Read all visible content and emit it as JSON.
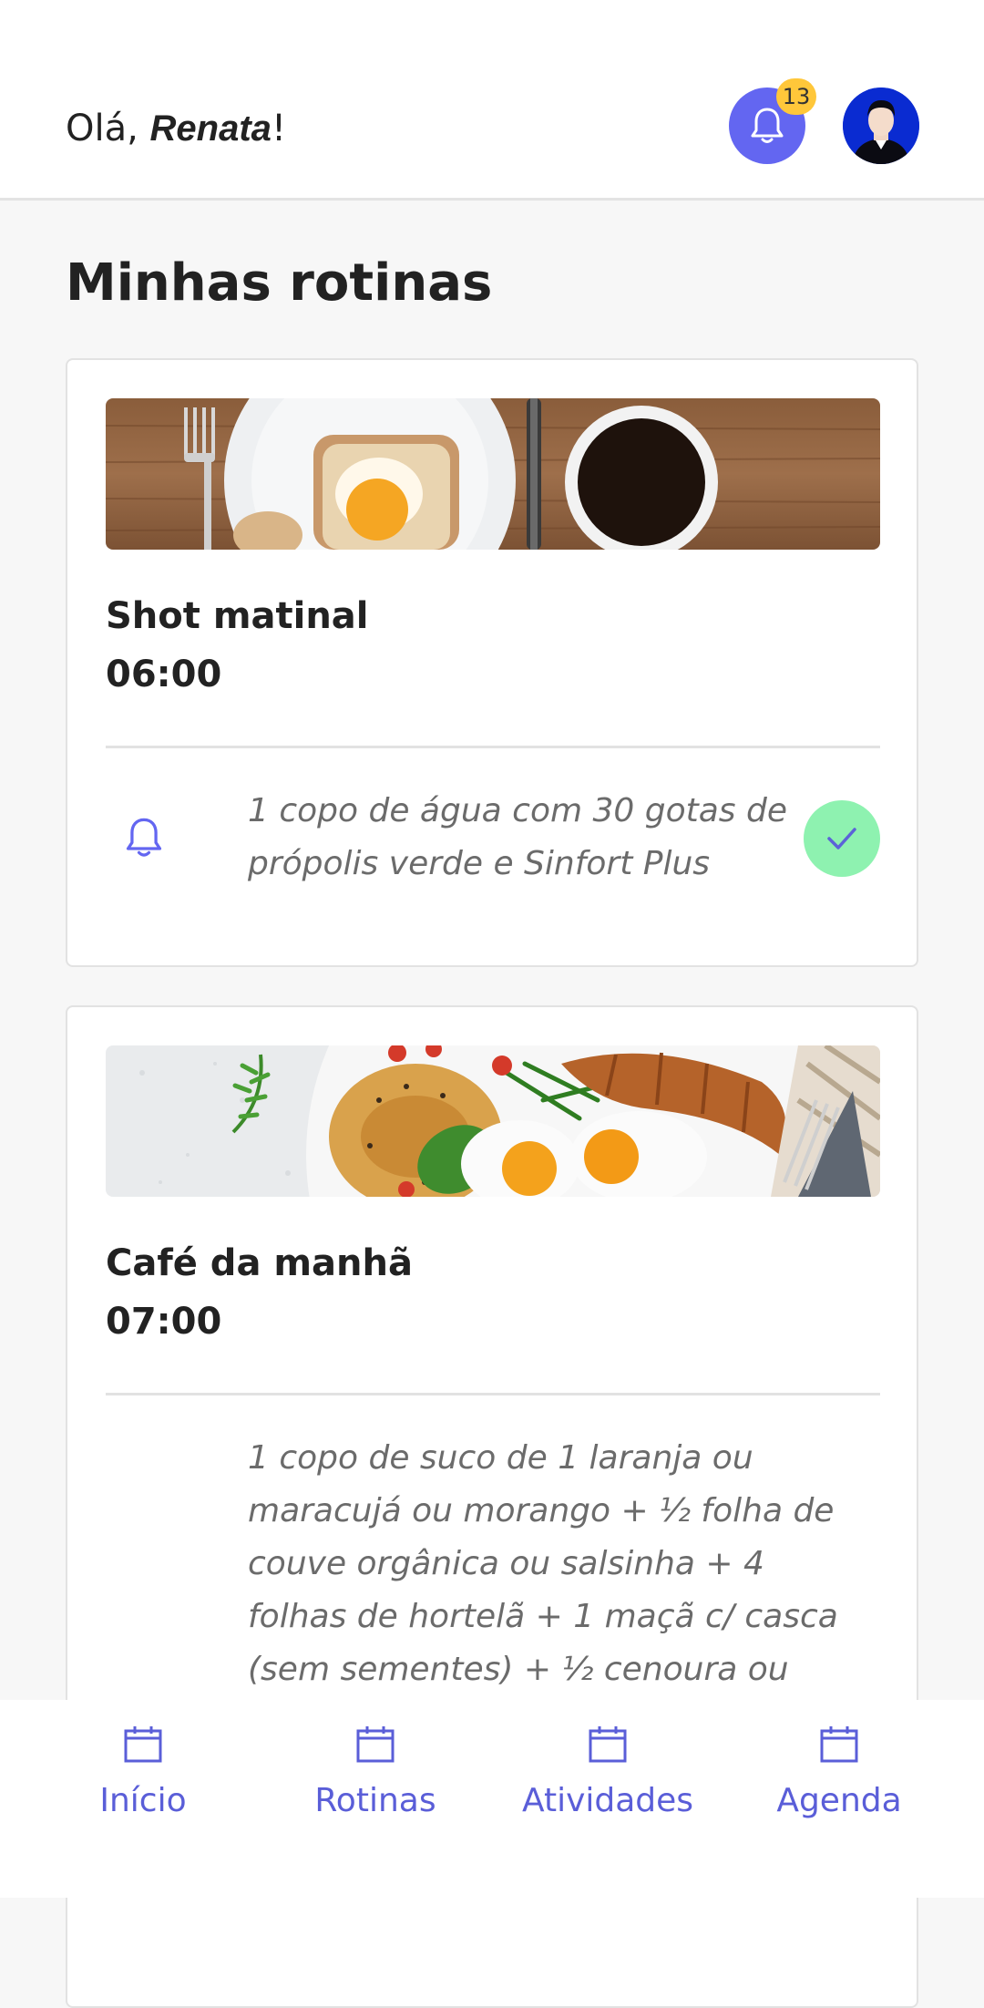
{
  "header": {
    "greeting_prefix": "Olá, ",
    "user_name": "Renata",
    "greeting_suffix": "!",
    "notification_count": "13"
  },
  "page": {
    "title": "Minhas rotinas"
  },
  "routines": [
    {
      "title": "Shot matinal",
      "time": "06:00",
      "description_lines": [
        "1 copo de água com 30 gotas de",
        "própolis verde e Sinfort Plus"
      ]
    },
    {
      "title": "Café da manhã",
      "time": "07:00",
      "description_lines": [
        "1 copo de suco de 1 laranja ou",
        "maracujá ou morango + ½ folha de",
        "couve orgânica ou salsinha + 4",
        "folhas de hortelã + 1 maçã c/ casca",
        "(sem sementes) + ½ cenoura ou"
      ]
    }
  ],
  "nav": {
    "items": [
      {
        "label": "Início",
        "icon": "calendar-icon"
      },
      {
        "label": "Rotinas",
        "icon": "calendar-icon"
      },
      {
        "label": "Atividades",
        "icon": "calendar-icon"
      },
      {
        "label": "Agenda",
        "icon": "calendar-icon"
      }
    ]
  },
  "colors": {
    "accent": "#6366f1",
    "badge": "#ffc73a",
    "check": "#8ef2b0",
    "avatar_bg": "#0a2bd1"
  }
}
